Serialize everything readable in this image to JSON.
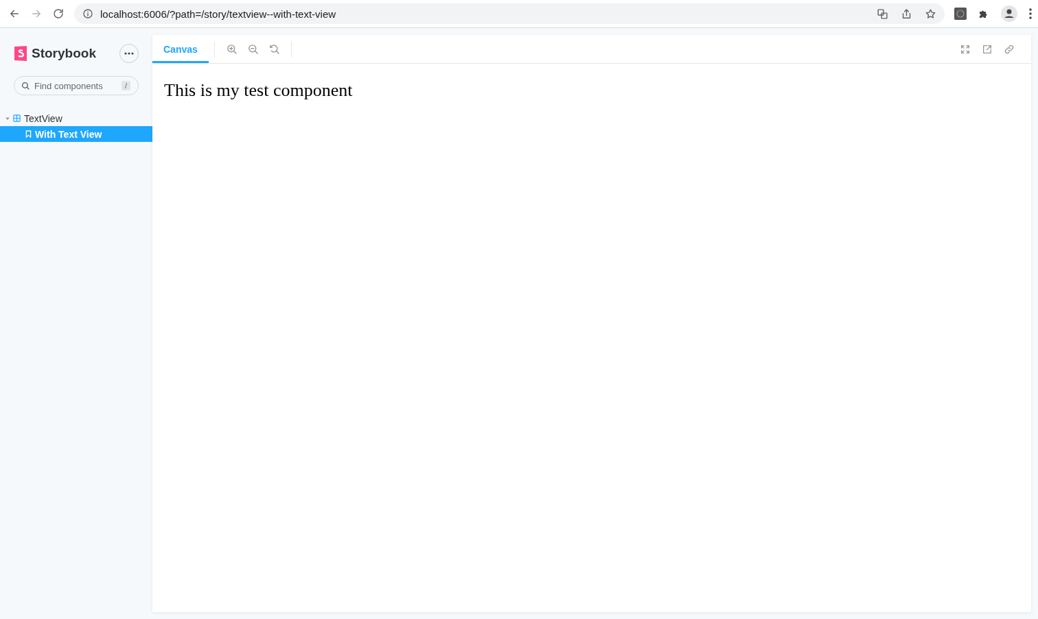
{
  "browser": {
    "url": "localhost:6006/?path=/story/textview--with-text-view"
  },
  "sidebar": {
    "brand": "Storybook",
    "search": {
      "placeholder": "Find components",
      "shortcut": "/"
    },
    "tree": [
      {
        "label": "TextView",
        "kind": "component",
        "expanded": true,
        "selected": false,
        "children": [
          {
            "label": "With Text View",
            "kind": "story",
            "selected": true
          }
        ]
      }
    ]
  },
  "toolbar": {
    "tabs": [
      {
        "label": "Canvas",
        "selected": true
      }
    ]
  },
  "preview": {
    "text": "This is my test component"
  }
}
